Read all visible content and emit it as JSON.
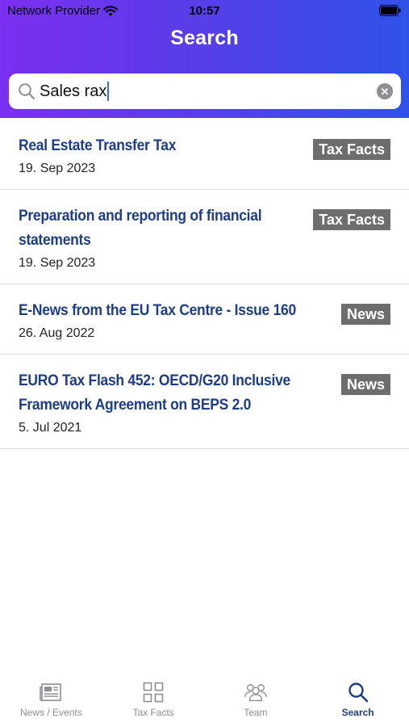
{
  "status_bar": {
    "carrier": "Network Provider",
    "time": "10:57"
  },
  "header": {
    "title": "Search"
  },
  "search": {
    "value": "Sales rax"
  },
  "results": [
    {
      "title": "Real Estate Transfer Tax",
      "date": "19. Sep 2023",
      "badge": "Tax Facts"
    },
    {
      "title": "Preparation and reporting of financial statements",
      "date": "19. Sep 2023",
      "badge": "Tax Facts"
    },
    {
      "title": "E-News from the EU Tax Centre - Issue 160",
      "date": "26. Aug 2022",
      "badge": "News"
    },
    {
      "title": "EURO Tax Flash 452: OECD/G20 Inclusive Framework Agreement on BEPS 2.0",
      "date": "5. Jul 2021",
      "badge": "News"
    }
  ],
  "tabbar": {
    "tabs": [
      {
        "label": "News / Events",
        "icon": "newspaper-icon"
      },
      {
        "label": "Tax Facts",
        "icon": "grid-icon"
      },
      {
        "label": "Team",
        "icon": "team-icon"
      },
      {
        "label": "Search",
        "icon": "search-icon",
        "active": true
      }
    ]
  },
  "colors": {
    "header_start": "#7b2ff0",
    "header_end": "#2f53e8",
    "title_blue": "#1d3d85",
    "badge_gray": "#6d6d6d",
    "inactive_gray": "#8e8e93"
  }
}
